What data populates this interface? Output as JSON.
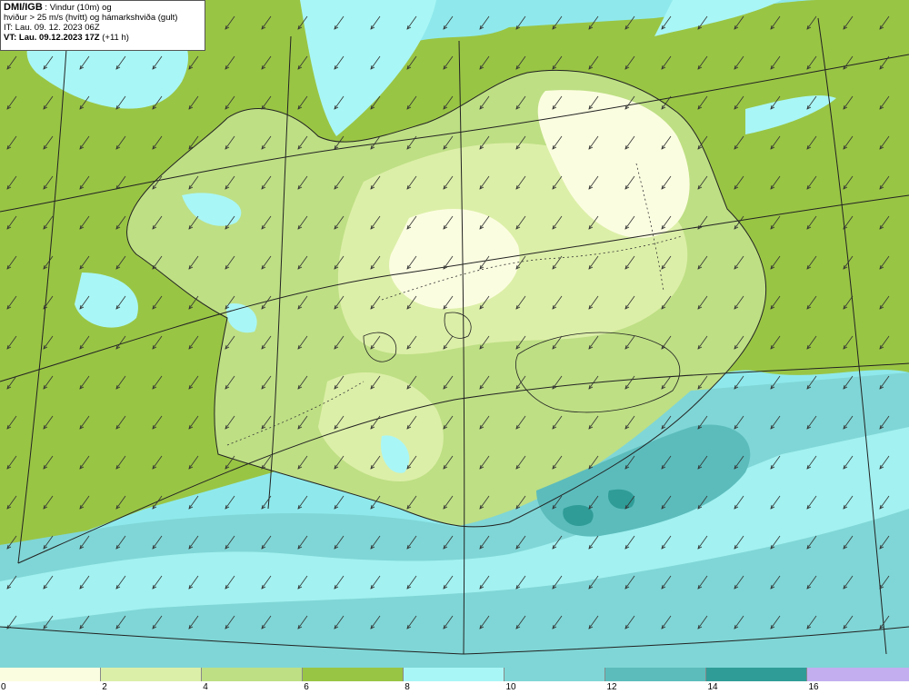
{
  "header": {
    "brand": "DMI/IGB",
    "line1_rest": ": Vindur (10m) og",
    "line2": "hviður > 25 m/s (hvítt) og hámarkshviða (gult)",
    "line3": "IT: Lau. 09. 12. 2023 06Z",
    "line4_bold": "VT: Lau. 09.12.2023 17Z",
    "line4_rest": "(+11 h)"
  },
  "colors": {
    "0-2": "#fbfde0",
    "2-4": "#dcefa8",
    "4-6": "#bedf84",
    "6-8": "#99c544",
    "8-10": "#a9f6f6",
    "10-12": "#80d6d6",
    "12-14": "#5cbcbc",
    "14-16": "#2f9c97",
    "16+": "#c3aef0"
  },
  "legend": {
    "ticks": [
      "0",
      "2",
      "4",
      "6",
      "8",
      "10",
      "12",
      "14",
      "16"
    ]
  }
}
